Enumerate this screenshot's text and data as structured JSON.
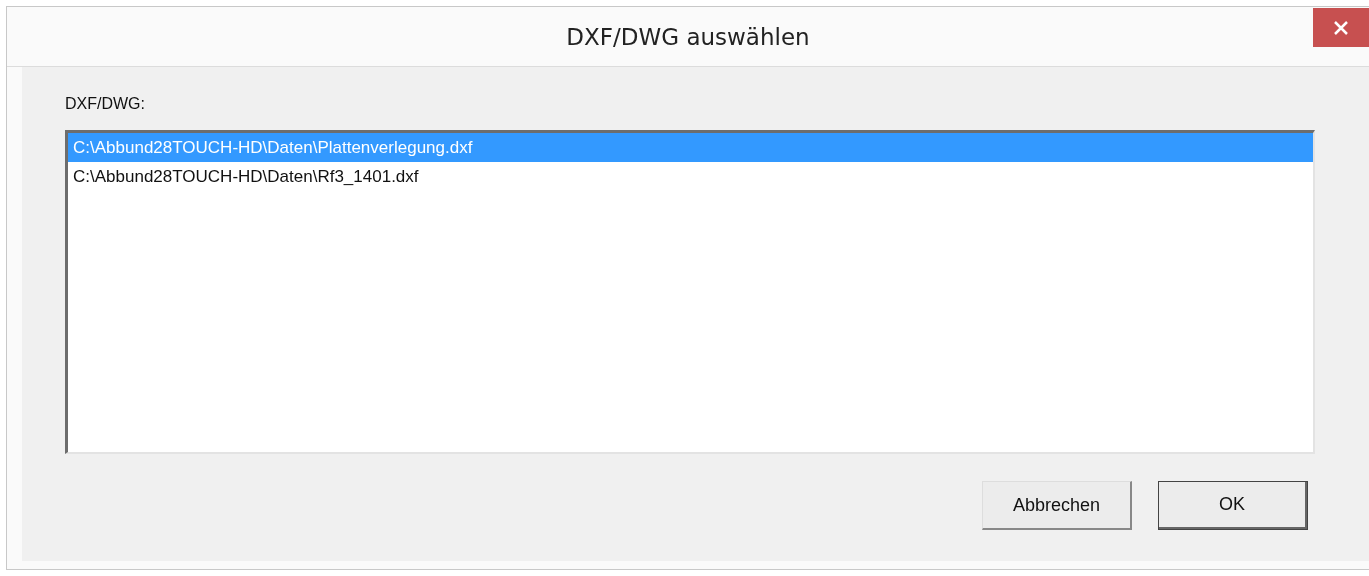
{
  "window": {
    "title": "DXF/DWG auswählen"
  },
  "list": {
    "label": "DXF/DWG:",
    "items": [
      {
        "text": "C:\\Abbund28TOUCH-HD\\Daten\\Plattenverlegung.dxf",
        "selected": true
      },
      {
        "text": "C:\\Abbund28TOUCH-HD\\Daten\\Rf3_1401.dxf",
        "selected": false
      }
    ]
  },
  "buttons": [
    {
      "label": "Abbrechen",
      "default": false
    },
    {
      "label": "OK",
      "default": true
    }
  ]
}
